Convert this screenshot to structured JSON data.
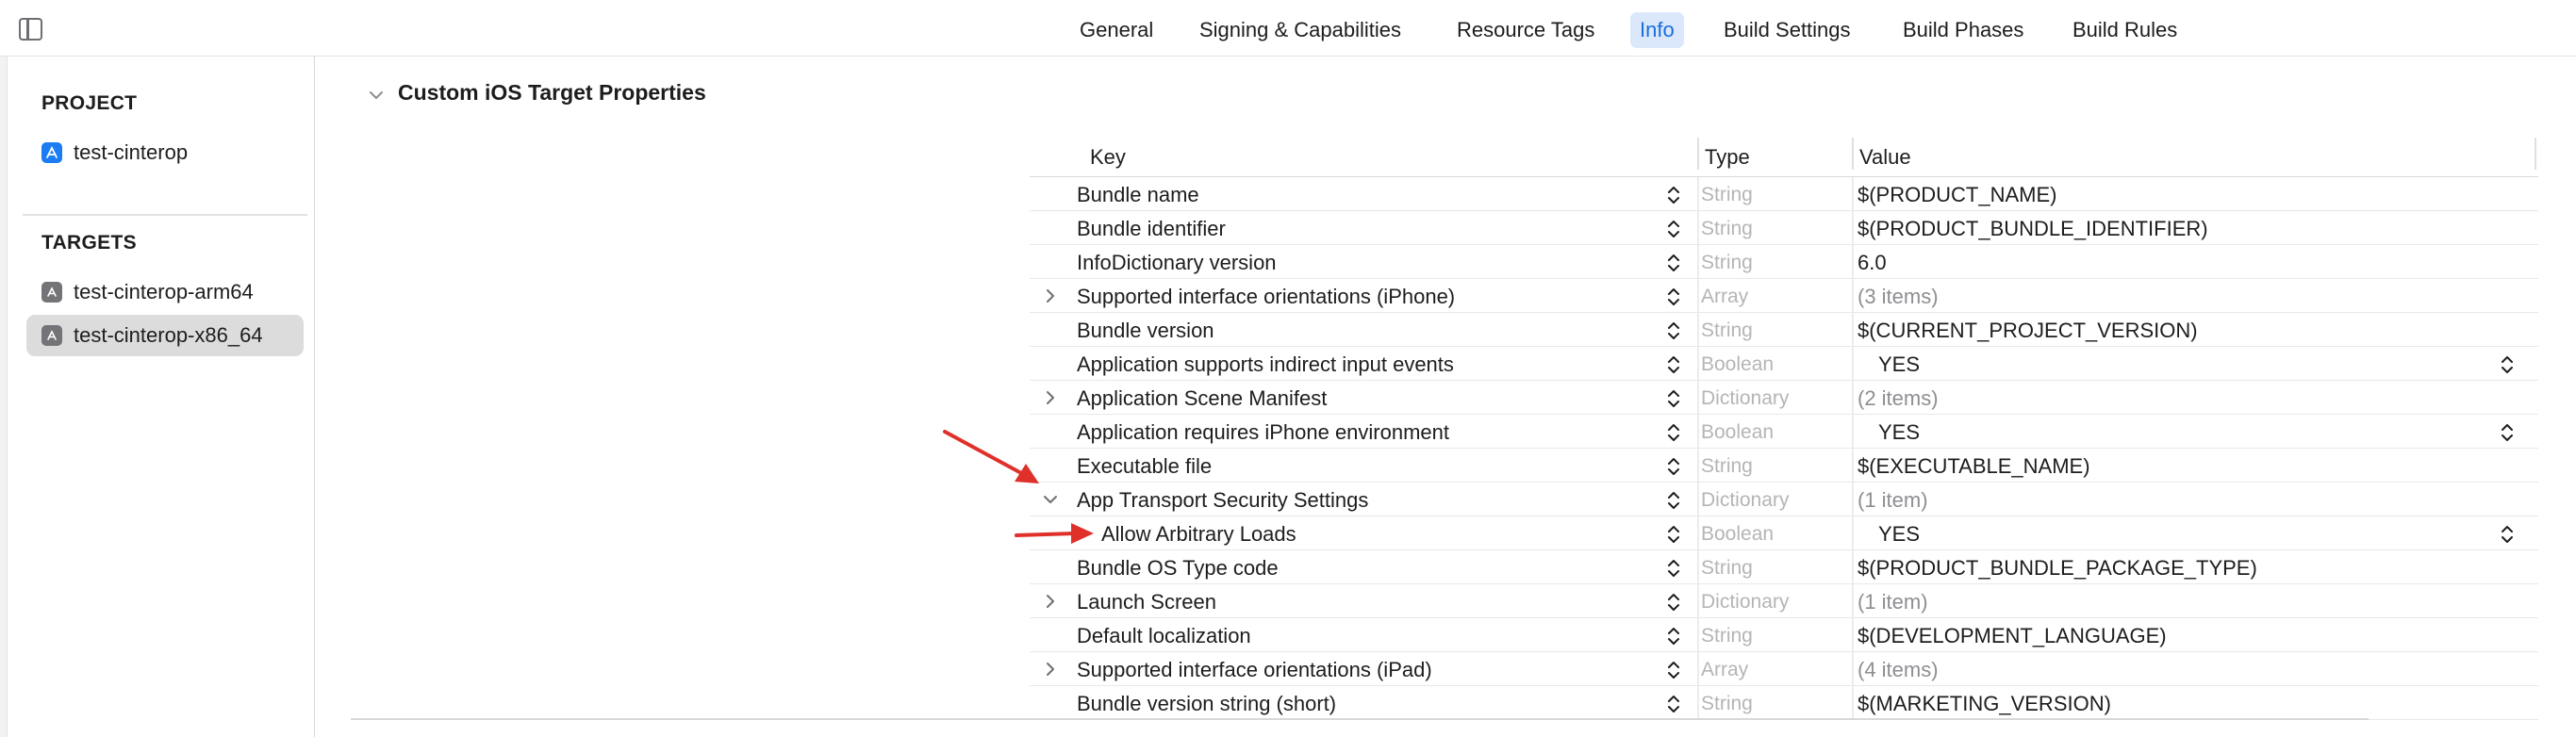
{
  "tabs": [
    {
      "label": "General",
      "active": false
    },
    {
      "label": "Signing & Capabilities",
      "active": false
    },
    {
      "label": "Resource Tags",
      "active": false
    },
    {
      "label": "Info",
      "active": true
    },
    {
      "label": "Build Settings",
      "active": false
    },
    {
      "label": "Build Phases",
      "active": false
    },
    {
      "label": "Build Rules",
      "active": false
    }
  ],
  "sidebar": {
    "project_heading": "PROJECT",
    "project_items": [
      {
        "label": "test-cinterop",
        "icon": "xcode-project-icon"
      }
    ],
    "targets_heading": "TARGETS",
    "target_items": [
      {
        "label": "test-cinterop-arm64",
        "icon": "app-target-icon",
        "selected": false
      },
      {
        "label": "test-cinterop-x86_64",
        "icon": "app-target-icon",
        "selected": true
      }
    ]
  },
  "section": {
    "title": "Custom iOS Target Properties"
  },
  "table": {
    "headers": {
      "key": "Key",
      "type": "Type",
      "value": "Value"
    },
    "rows": [
      {
        "key": "Bundle name",
        "type": "String",
        "value": "$(PRODUCT_NAME)",
        "disclosure": "none",
        "indent": 0,
        "popup": false
      },
      {
        "key": "Bundle identifier",
        "type": "String",
        "value": "$(PRODUCT_BUNDLE_IDENTIFIER)",
        "disclosure": "none",
        "indent": 0,
        "popup": false
      },
      {
        "key": "InfoDictionary version",
        "type": "String",
        "value": "6.0",
        "disclosure": "none",
        "indent": 0,
        "popup": false
      },
      {
        "key": "Supported interface orientations (iPhone)",
        "type": "Array",
        "value": "(3 items)",
        "disclosure": "collapsed",
        "indent": 0,
        "popup": false
      },
      {
        "key": "Bundle version",
        "type": "String",
        "value": "$(CURRENT_PROJECT_VERSION)",
        "disclosure": "none",
        "indent": 0,
        "popup": false
      },
      {
        "key": "Application supports indirect input events",
        "type": "Boolean",
        "value": "YES",
        "disclosure": "none",
        "indent": 0,
        "popup": true
      },
      {
        "key": "Application Scene Manifest",
        "type": "Dictionary",
        "value": "(2 items)",
        "disclosure": "collapsed",
        "indent": 0,
        "popup": false
      },
      {
        "key": "Application requires iPhone environment",
        "type": "Boolean",
        "value": "YES",
        "disclosure": "none",
        "indent": 0,
        "popup": true
      },
      {
        "key": "Executable file",
        "type": "String",
        "value": "$(EXECUTABLE_NAME)",
        "disclosure": "none",
        "indent": 0,
        "popup": false
      },
      {
        "key": "App Transport Security Settings",
        "type": "Dictionary",
        "value": "(1 item)",
        "disclosure": "expanded",
        "indent": 0,
        "popup": false
      },
      {
        "key": "Allow Arbitrary Loads",
        "type": "Boolean",
        "value": "YES",
        "disclosure": "none",
        "indent": 1,
        "popup": true
      },
      {
        "key": "Bundle OS Type code",
        "type": "String",
        "value": "$(PRODUCT_BUNDLE_PACKAGE_TYPE)",
        "disclosure": "none",
        "indent": 0,
        "popup": false
      },
      {
        "key": "Launch Screen",
        "type": "Dictionary",
        "value": "(1 item)",
        "disclosure": "collapsed",
        "indent": 0,
        "popup": false
      },
      {
        "key": "Default localization",
        "type": "String",
        "value": "$(DEVELOPMENT_LANGUAGE)",
        "disclosure": "none",
        "indent": 0,
        "popup": false
      },
      {
        "key": "Supported interface orientations (iPad)",
        "type": "Array",
        "value": "(4 items)",
        "disclosure": "collapsed",
        "indent": 0,
        "popup": false
      },
      {
        "key": "Bundle version string (short)",
        "type": "String",
        "value": "$(MARKETING_VERSION)",
        "disclosure": "none",
        "indent": 0,
        "popup": false
      }
    ]
  },
  "annotations": {
    "arrow_color": "#e0302a",
    "arrow_targets": [
      "App Transport Security Settings",
      "Allow Arbitrary Loads"
    ]
  }
}
